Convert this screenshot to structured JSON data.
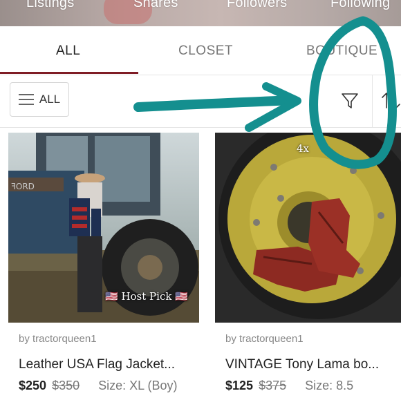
{
  "stats": {
    "listings": "Listings",
    "shares": "Shares",
    "followers": "Followers",
    "following": "Following"
  },
  "tabs": [
    {
      "label": "ALL",
      "active": true
    },
    {
      "label": "CLOSET",
      "active": false
    },
    {
      "label": "BOUTIQUE",
      "active": false
    }
  ],
  "toolbar": {
    "filter_label": "ALL",
    "filter_icon": "funnel-icon",
    "sort_icon": "sort-icon"
  },
  "listings": [
    {
      "seller": "by tractorqueen1",
      "title": "Leather USA Flag Jacket...",
      "price": "$250",
      "original_price": "$350",
      "size": "Size: XL (Boy)",
      "badge": "🇺🇸 Host Pick 🇺🇸"
    },
    {
      "seller": "by tractorqueen1",
      "title": "VINTAGE Tony Lama bo...",
      "price": "$125",
      "original_price": "$375",
      "size": "Size: 8.5",
      "badge": "4x"
    }
  ],
  "colors": {
    "accent": "#7f1c25",
    "annotation": "#148f8f"
  }
}
